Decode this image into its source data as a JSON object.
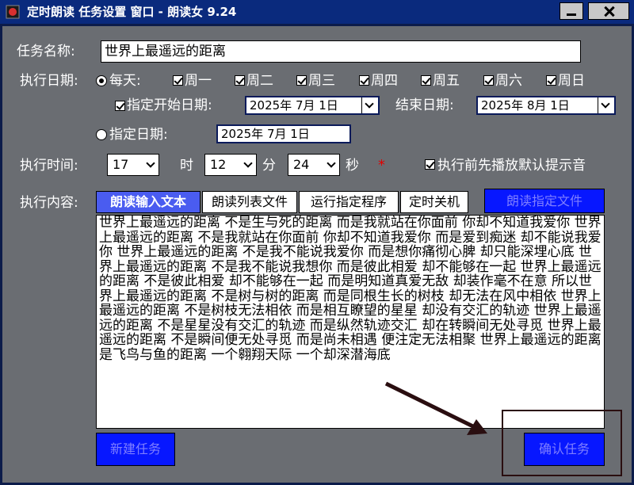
{
  "window": {
    "title": "定时朗读 任务设置 窗口 - 朗读女 9.24",
    "icon": "app-icon"
  },
  "form": {
    "task_name_label": "任务名称:",
    "task_name_value": "世界上最遥远的距离",
    "exec_date_label": "执行日期:",
    "daily_label": "每天:",
    "weekdays": [
      "周一",
      "周二",
      "周三",
      "周四",
      "周五",
      "周六",
      "周日"
    ],
    "start_date_label": "指定开始日期:",
    "start_date_value": "2025年 7月 1日",
    "end_date_label": "结束日期:",
    "end_date_value": "2025年 8月 1日",
    "specific_date_label": "指定日期:",
    "specific_date_value": "2025年 7月 1日",
    "exec_time_label": "执行时间:",
    "hour_value": "17",
    "hour_unit": "时",
    "minute_value": "12",
    "minute_unit": "分",
    "second_value": "24",
    "second_unit": "秒",
    "star": "*",
    "play_sound_label": "执行前先播放默认提示音",
    "exec_content_label": "执行内容:"
  },
  "tabs": [
    "朗读输入文本",
    "朗读列表文件",
    "运行指定程序",
    "定时关机"
  ],
  "buttons": {
    "read_file": "朗读指定文件",
    "new_task": "新建任务",
    "confirm_task": "确认任务"
  },
  "content_text": "世界上最遥远的距离 不是生与死的距离 而是我就站在你面前 你却不知道我爱你 世界上最遥远的距离 不是我就站在你面前 你却不知道我爱你 而是爱到痴迷 却不能说我爱你 世界上最遥远的距离 不是我不能说我爱你 而是想你痛彻心脾 却只能深埋心底 世界上最遥远的距离 不是我不能说我想你 而是彼此相爱 却不能够在一起 世界上最遥远的距离 不是彼此相爱 却不能够在一起 而是明知道真爱无敌 却装作毫不在意 所以世界上最遥远的距离 不是树与树的距离 而是同根生长的树枝 却无法在风中相依 世界上最遥远的距离 不是树枝无法相依 而是相互瞭望的星星 却没有交汇的轨迹 世界上最遥远的距离 不是星星没有交汇的轨迹 而是纵然轨迹交汇 却在转瞬间无处寻觅 世界上最遥远的距离 不是瞬间便无处寻觅 而是尚未相遇 便注定无法相聚 世界上最遥远的距离 是飞鸟与鱼的距离 一个翱翔天际 一个却深潜海底",
  "colors": {
    "title_bar": "#0a2a7d",
    "client_bg": "#6a6d72",
    "blue_button": "#0717ff",
    "active_tab": "#4a5cf0",
    "annotation_arrow": "#2a0e10"
  }
}
